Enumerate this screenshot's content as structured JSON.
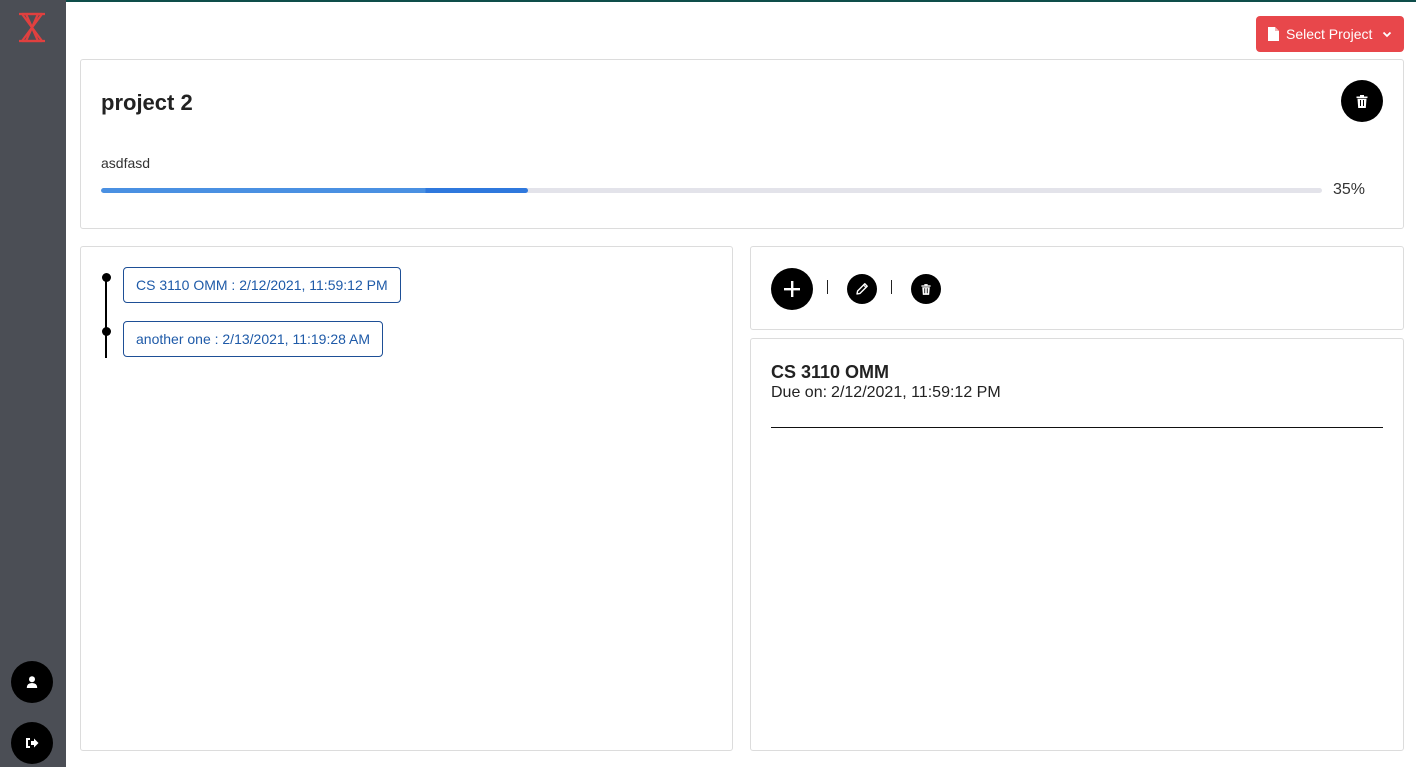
{
  "header": {
    "select_project_label": "Select Project"
  },
  "project": {
    "title": "project 2",
    "description": "asdfasd",
    "progress_percent": 35,
    "progress_label": "35%"
  },
  "timeline": {
    "items": [
      {
        "label": "CS 3110 OMM : 2/12/2021, 11:59:12 PM"
      },
      {
        "label": "another one : 2/13/2021, 11:19:28 AM"
      }
    ]
  },
  "actions": {
    "separator": "|"
  },
  "detail": {
    "title": "CS 3110 OMM",
    "due_prefix": "Due on:",
    "due_value": "2/12/2021, 11:59:12 PM"
  },
  "icons": {
    "logo": "hourglass-logo",
    "project_menu": "file-icon",
    "dropdown": "chevron-down-icon",
    "delete": "trash-icon",
    "add": "plus-icon",
    "edit": "pencil-icon",
    "user": "user-icon",
    "logout": "logout-icon"
  },
  "colors": {
    "sidebar": "#4b4e55",
    "accent_red": "#e8474b",
    "progress_blue": "#4a90e2",
    "timeline_border": "#1e4f96"
  }
}
